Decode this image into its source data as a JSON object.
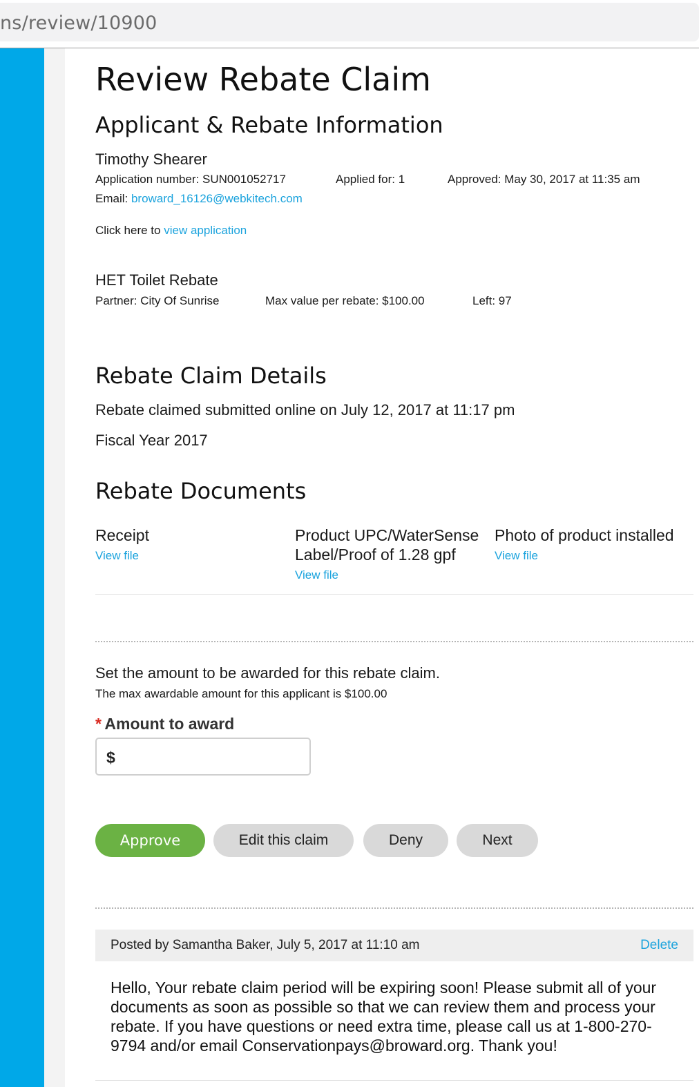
{
  "browser": {
    "url_text": "ns/review/10900"
  },
  "page": {
    "title": "Review Rebate Claim"
  },
  "applicant_section": {
    "heading": "Applicant & Rebate Information",
    "name": "Timothy Shearer",
    "application_number": "Application number: SUN001052717",
    "applied_for": "Applied for: 1",
    "approved": "Approved: May 30, 2017 at 11:35 am",
    "email_label": "Email:",
    "email_value": "broward_16126@webkitech.com",
    "click_here_text": "Click here to",
    "view_application_link": "view application"
  },
  "rebate": {
    "name": "HET Toilet Rebate",
    "partner": "Partner: City Of Sunrise",
    "max_value": "Max value per rebate: $100.00",
    "left": "Left: 97"
  },
  "claim_details": {
    "heading": "Rebate Claim Details",
    "submitted": "Rebate claimed submitted online on July 12, 2017 at 11:17 pm",
    "fiscal_year": "Fiscal Year 2017"
  },
  "documents": {
    "heading": "Rebate Documents",
    "items": [
      {
        "title_line1": "Receipt",
        "title_line2": "",
        "link": "View file"
      },
      {
        "title_line1": "Product UPC/WaterSense",
        "title_line2": "Label/Proof of 1.28 gpf",
        "link": "View file"
      },
      {
        "title_line1": "Photo of product installed",
        "title_line2": "",
        "link": "View file"
      }
    ]
  },
  "award": {
    "instruction": "Set the amount to be awarded for this rebate claim.",
    "max_note": "The max awardable amount for this applicant is $100.00",
    "required_mark": "*",
    "field_label": "Amount to award",
    "currency_symbol": "$",
    "value": ""
  },
  "actions": {
    "approve": "Approve",
    "edit": "Edit this claim",
    "deny": "Deny",
    "next": "Next"
  },
  "note": {
    "posted_by": "Posted by Samantha Baker, July 5, 2017 at 11:10 am",
    "delete": "Delete",
    "body": "Hello, Your rebate claim period will be expiring soon! Please submit all of your documents as soon as possible so that we can review them and process your rebate. If you have questions or need extra time, please call us at 1-800-270-9794 and/or email Conservationpays@broward.org. Thank you!"
  },
  "colors": {
    "sidebar": "#00a8e8",
    "link": "#1ba3dd",
    "approve_button": "#6bb244",
    "grey_button": "#d9d9d9",
    "required": "#d9281f"
  }
}
